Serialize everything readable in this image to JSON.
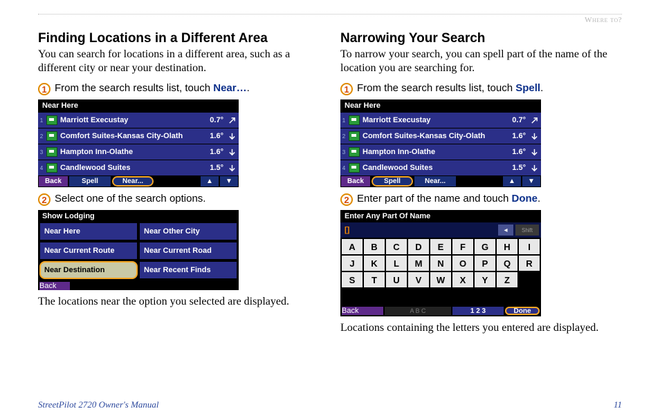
{
  "breadcrumb": "Where to?",
  "left": {
    "heading": "Finding Locations in a Different Area",
    "intro": "You can search for locations in a different area, such as a different city or near your destination.",
    "step1_prefix": "From the search results list, touch ",
    "step1_kw": "Near…",
    "step1_suffix": ".",
    "step2": "Select one of the search options.",
    "after": "The locations near the option you selected are displayed."
  },
  "right": {
    "heading": "Narrowing Your Search",
    "intro": "To narrow your search, you can spell part of the name of the location you are searching for.",
    "step1_prefix": "From the search results list, touch ",
    "step1_kw": "Spell",
    "step1_suffix": ".",
    "step2_prefix": "Enter part of the name and touch ",
    "step2_kw": "Done",
    "step2_suffix": ".",
    "after": "Locations containing the letters you entered are displayed."
  },
  "results": {
    "title": "Near Here",
    "rows": [
      {
        "idx": "1",
        "name": "Marriott Execustay",
        "dist": "0.7°",
        "dir": "ne"
      },
      {
        "idx": "2",
        "name": "Comfort Suites-Kansas City-Olath",
        "dist": "1.6°",
        "dir": "s"
      },
      {
        "idx": "3",
        "name": "Hampton Inn-Olathe",
        "dist": "1.6°",
        "dir": "s"
      },
      {
        "idx": "4",
        "name": "Candlewood Suites",
        "dist": "1.5°",
        "dir": "s"
      }
    ],
    "back": "Back",
    "spell": "Spell",
    "near": "Near..."
  },
  "lodging": {
    "title": "Show Lodging",
    "opts": [
      "Near Here",
      "Near Other City",
      "Near Current Route",
      "Near Current Road",
      "Near Destination",
      "Near Recent Finds"
    ],
    "back": "Back"
  },
  "keyboard": {
    "title": "Enter Any Part Of Name",
    "input": "[]",
    "bksp": "◂",
    "shift": "Shift",
    "keys": [
      "A",
      "B",
      "C",
      "D",
      "E",
      "F",
      "G",
      "H",
      "I",
      "J",
      "K",
      "L",
      "M",
      "N",
      "O",
      "P",
      "Q",
      "R",
      "S",
      "T",
      "U",
      "V",
      "W",
      "X",
      "Y",
      "Z",
      "",
      ""
    ],
    "back": "Back",
    "abc": "A B C",
    "num": "1 2 3",
    "done": "Done"
  },
  "footer_left": "StreetPilot 2720 Owner's Manual",
  "footer_right": "11"
}
